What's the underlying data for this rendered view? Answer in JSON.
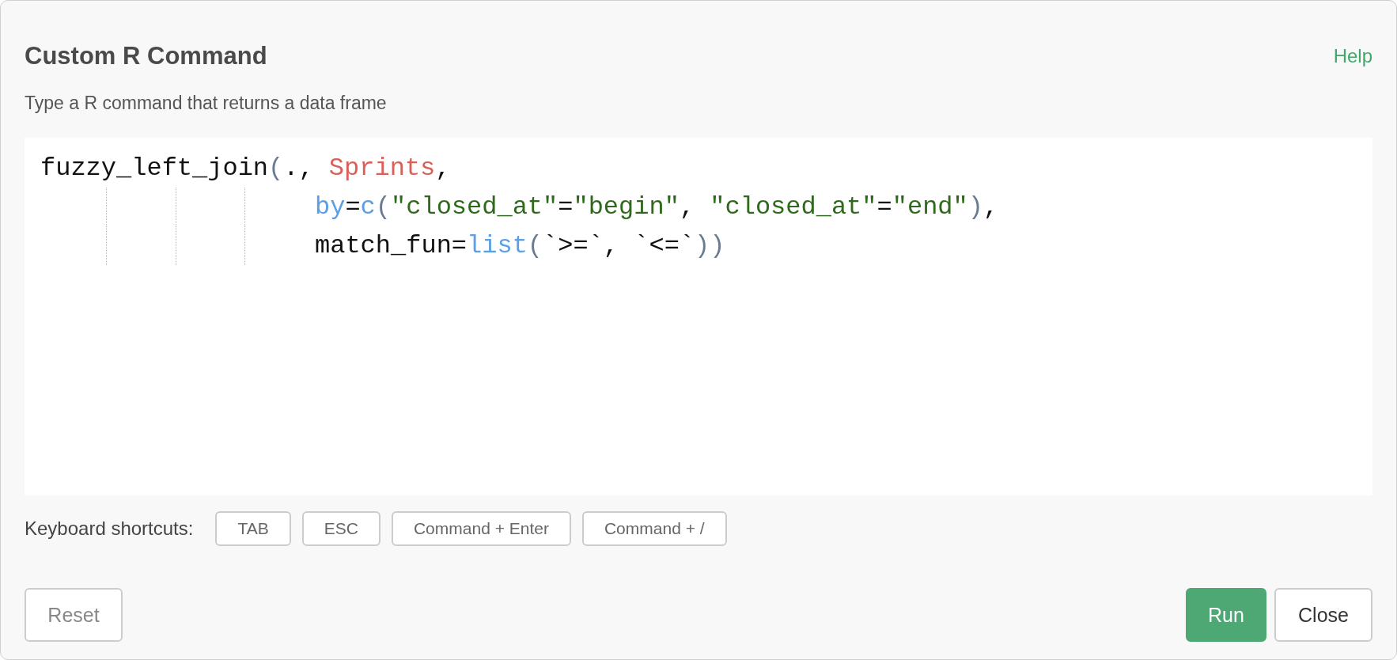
{
  "dialog": {
    "title": "Custom R Command",
    "help_link": "Help",
    "subtitle": "Type a R command that returns a data frame"
  },
  "editor": {
    "lines": [
      {
        "indented": false,
        "tokens": [
          {
            "kind": "plain",
            "text": "fuzzy_left_join"
          },
          {
            "kind": "punct",
            "text": "("
          },
          {
            "kind": "plain",
            "text": "., "
          },
          {
            "kind": "variable",
            "text": "Sprints"
          },
          {
            "kind": "plain",
            "text": ","
          }
        ]
      },
      {
        "indented": true,
        "tokens": [
          {
            "kind": "keyword",
            "text": "by"
          },
          {
            "kind": "plain",
            "text": "="
          },
          {
            "kind": "keyword",
            "text": "c"
          },
          {
            "kind": "punct",
            "text": "("
          },
          {
            "kind": "string",
            "text": "\"closed_at\""
          },
          {
            "kind": "plain",
            "text": "="
          },
          {
            "kind": "string",
            "text": "\"begin\""
          },
          {
            "kind": "plain",
            "text": ", "
          },
          {
            "kind": "string",
            "text": "\"closed_at\""
          },
          {
            "kind": "plain",
            "text": "="
          },
          {
            "kind": "string",
            "text": "\"end\""
          },
          {
            "kind": "punct",
            "text": ")"
          },
          {
            "kind": "plain",
            "text": ","
          }
        ]
      },
      {
        "indented": true,
        "tokens": [
          {
            "kind": "plain",
            "text": "match_fun="
          },
          {
            "kind": "keyword",
            "text": "list"
          },
          {
            "kind": "punct",
            "text": "("
          },
          {
            "kind": "plain",
            "text": "`>=`, `<=`"
          },
          {
            "kind": "punct",
            "text": "))"
          }
        ]
      }
    ]
  },
  "shortcuts": {
    "label": "Keyboard shortcuts:",
    "keys": [
      "TAB",
      "ESC",
      "Command + Enter",
      "Command + /"
    ]
  },
  "buttons": {
    "reset": "Reset",
    "run": "Run",
    "close": "Close"
  }
}
